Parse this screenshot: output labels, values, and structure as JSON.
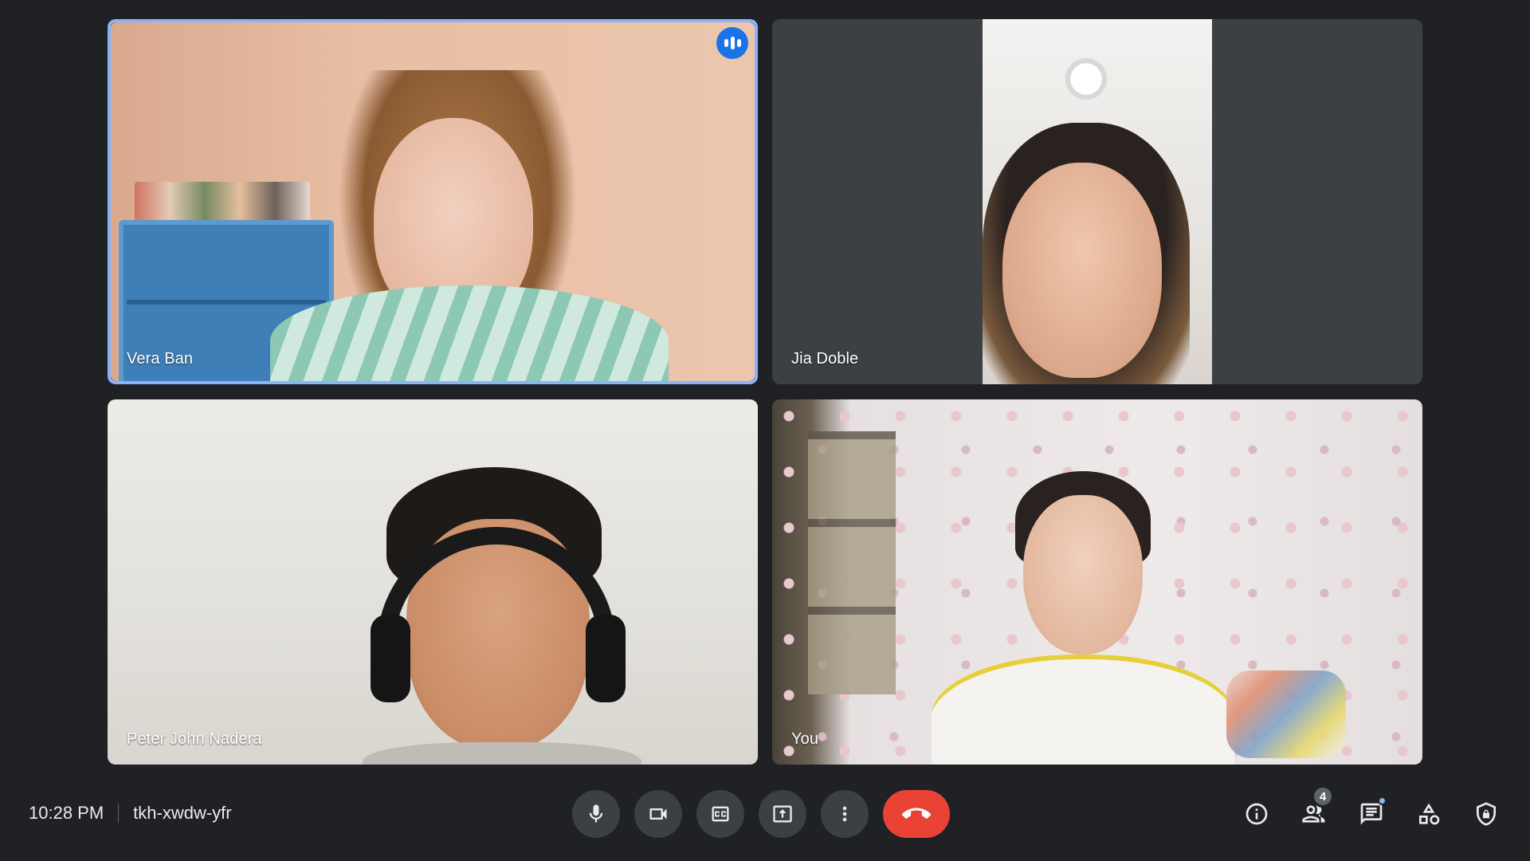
{
  "participants": [
    {
      "name": "Vera Ban",
      "speaking": true
    },
    {
      "name": "Jia Doble",
      "speaking": false
    },
    {
      "name": "Peter John Nadera",
      "speaking": false
    },
    {
      "name": "You",
      "speaking": false
    }
  ],
  "bottom_bar": {
    "time": "10:28 PM",
    "meeting_code": "tkh-xwdw-yfr",
    "controls": [
      "microphone-icon",
      "camera-icon",
      "captions-icon",
      "present-icon",
      "more-options-icon",
      "leave-call-icon"
    ],
    "right_actions": {
      "info": "info-icon",
      "people": "people-icon",
      "people_count": "4",
      "chat": "chat-icon",
      "activities": "activities-icon",
      "host_controls": "shield-lock-icon"
    }
  },
  "colors": {
    "background": "#202124",
    "speaking_border": "#8ab4f8",
    "end_call": "#ea4335",
    "speaking_indicator": "#1a73e8"
  }
}
